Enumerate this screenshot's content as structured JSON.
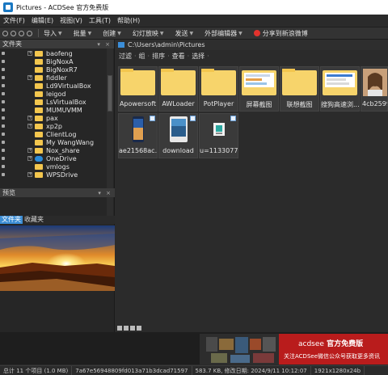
{
  "window": {
    "title": "Pictures - ACDSee 官方免费版"
  },
  "menu": [
    "文件(F)",
    "编辑(E)",
    "视图(V)",
    "工具(T)",
    "帮助(H)"
  ],
  "toolbar": {
    "items": [
      {
        "label": "导入",
        "dropdown": true
      },
      {
        "label": "批量",
        "dropdown": true
      },
      {
        "label": "创建",
        "dropdown": true
      },
      {
        "label": "幻灯放映",
        "dropdown": true
      },
      {
        "label": "发送",
        "dropdown": true
      },
      {
        "label": "外部编辑器",
        "dropdown": true
      }
    ],
    "share_label": "分享到新浪微博"
  },
  "folders_panel": {
    "title": "文件夹",
    "tree": [
      {
        "label": "baofeng",
        "expandable": true,
        "type": "folder"
      },
      {
        "label": "BigNoxA",
        "expandable": false,
        "type": "folder"
      },
      {
        "label": "BigNoxR7",
        "expandable": false,
        "type": "folder"
      },
      {
        "label": "fiddler",
        "expandable": true,
        "type": "folder"
      },
      {
        "label": "Ld9VirtualBox",
        "expandable": false,
        "type": "folder"
      },
      {
        "label": "leigod",
        "expandable": false,
        "type": "folder"
      },
      {
        "label": "LsVirtualBox",
        "expandable": false,
        "type": "folder"
      },
      {
        "label": "MUMUVMM",
        "expandable": false,
        "type": "folder"
      },
      {
        "label": "pax",
        "expandable": true,
        "type": "folder"
      },
      {
        "label": "xp2p",
        "expandable": true,
        "type": "folder"
      },
      {
        "label": "ClientLog",
        "expandable": false,
        "type": "folder"
      },
      {
        "label": "My WangWang",
        "expandable": false,
        "type": "folder"
      },
      {
        "label": "Nox_share",
        "expandable": true,
        "type": "folder"
      },
      {
        "label": "OneDrive",
        "expandable": true,
        "type": "cloud"
      },
      {
        "label": "vmlogs",
        "expandable": false,
        "type": "folder"
      },
      {
        "label": "WPSDrive",
        "expandable": true,
        "type": "folder"
      }
    ],
    "tabs": [
      "文件夹",
      "收藏夹"
    ]
  },
  "preview_panel": {
    "title": "预览"
  },
  "main": {
    "path": "C:\\Users\\admin\\Pictures",
    "filters": [
      "过滤",
      "组",
      "排序",
      "查看",
      "选择"
    ],
    "thumbnails": [
      {
        "label": "Apowersoft",
        "kind": "folder"
      },
      {
        "label": "AWLoader",
        "kind": "folder"
      },
      {
        "label": "PotPlayer",
        "kind": "folder"
      },
      {
        "label": "屏幕截图",
        "kind": "folder-shot"
      },
      {
        "label": "联想截图",
        "kind": "folder"
      },
      {
        "label": "搜狗高速浏...",
        "kind": "folder-shot"
      },
      {
        "label": "4cb2599a...",
        "kind": "portrait"
      },
      {
        "label": "ae21568ac...",
        "kind": "phone"
      },
      {
        "label": "download",
        "kind": "phone2"
      },
      {
        "label": "u=1133077...",
        "kind": "small"
      }
    ]
  },
  "ad": {
    "brand": "acdsee",
    "edition": "官方免费版",
    "slogan": "关注ACDSee微信公众号获取更多资讯"
  },
  "status": {
    "total": "总计 11 个项目 (1.0 MB)",
    "filename": "7a67e56948809fd013a71b3dcad71597",
    "size_modified": "583.7 KB, 修改日期: 2024/9/11 10:12:07",
    "dimensions": "1921x1280x24b"
  },
  "colors": {
    "accent": "#3d8ed5",
    "folder": "#f7d46b",
    "ad_bg": "#b91c1c"
  }
}
